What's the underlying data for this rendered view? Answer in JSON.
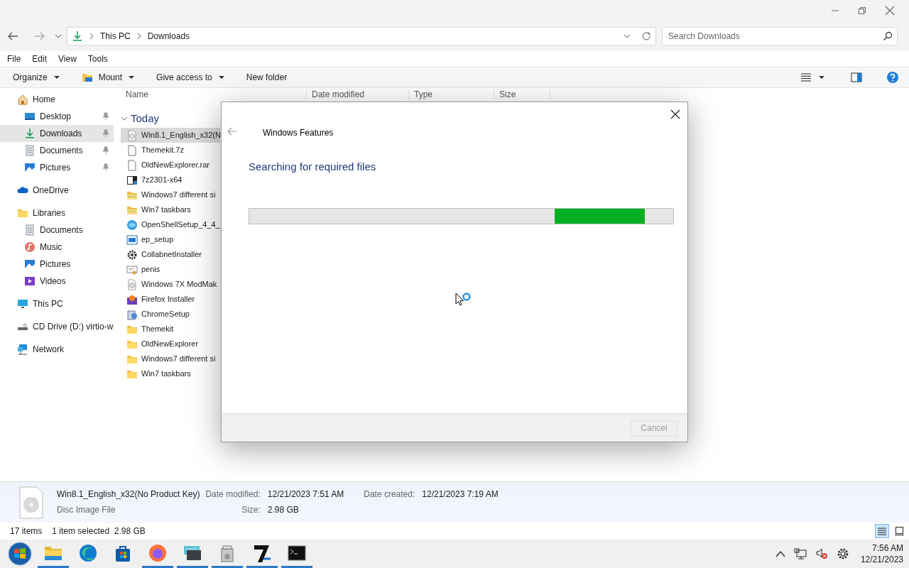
{
  "address_bar": {
    "path": [
      "This PC",
      "Downloads"
    ]
  },
  "search": {
    "placeholder": "Search Downloads"
  },
  "menu_bar": [
    "File",
    "Edit",
    "View",
    "Tools"
  ],
  "toolbar": [
    {
      "label": "Organize",
      "kind": "dropdown"
    },
    {
      "label": "Mount",
      "kind": "icon-dropdown"
    },
    {
      "label": "Give access to",
      "kind": "dropdown"
    },
    {
      "label": "New folder",
      "kind": "plain"
    }
  ],
  "navigation": [
    {
      "label": "Home",
      "kind": "home",
      "selected": false,
      "children": [
        {
          "label": "Desktop",
          "kind": "desktop",
          "pinned": true,
          "selected": false
        },
        {
          "label": "Downloads",
          "kind": "downloads",
          "pinned": true,
          "selected": true
        },
        {
          "label": "Documents",
          "kind": "documents",
          "pinned": true,
          "selected": false
        },
        {
          "label": "Pictures",
          "kind": "pictures",
          "pinned": true,
          "selected": false
        }
      ]
    },
    {
      "label": "OneDrive",
      "kind": "cloud",
      "selected": false
    },
    {
      "label": "Libraries",
      "kind": "folder",
      "selected": false,
      "children": [
        {
          "label": "Documents",
          "kind": "documents",
          "selected": false
        },
        {
          "label": "Music",
          "kind": "music",
          "selected": false
        },
        {
          "label": "Pictures",
          "kind": "pictures",
          "selected": false
        },
        {
          "label": "Videos",
          "kind": "videos",
          "selected": false
        }
      ]
    },
    {
      "label": "This PC",
      "kind": "pc",
      "selected": false
    },
    {
      "label": "CD Drive (D:) virtio-w",
      "kind": "drive",
      "selected": false
    },
    {
      "label": "Network",
      "kind": "network",
      "selected": false
    }
  ],
  "file_list": {
    "columns": [
      "Name",
      "Date modified",
      "Type",
      "Size"
    ],
    "group": {
      "label": "Today",
      "expanded": true
    },
    "rows": [
      {
        "name": "Win8.1_English_x32(N",
        "kind": "disc",
        "selected": true
      },
      {
        "name": "Themekit.7z",
        "kind": "file",
        "selected": false
      },
      {
        "name": "OldNewExplorer.rar",
        "kind": "file",
        "selected": false
      },
      {
        "name": "7z2301-x64",
        "kind": "sevenzip",
        "selected": false
      },
      {
        "name": "Windows7 different si",
        "kind": "zipfolder",
        "selected": false
      },
      {
        "name": "Win7 taskbars",
        "kind": "zipfolder",
        "selected": false
      },
      {
        "name": "OpenShellSetup_4_4_",
        "kind": "shell",
        "selected": false
      },
      {
        "name": "ep_setup",
        "kind": "app",
        "selected": false
      },
      {
        "name": "CollabnetInstaller",
        "kind": "gear",
        "selected": false
      },
      {
        "name": "penis",
        "kind": "cert",
        "selected": false
      },
      {
        "name": "Windows 7X ModMak",
        "kind": "disc",
        "selected": false
      },
      {
        "name": "Firefox Installer",
        "kind": "installer",
        "selected": false
      },
      {
        "name": "ChromeSetup",
        "kind": "setup",
        "selected": false
      },
      {
        "name": "Themekit",
        "kind": "folder",
        "selected": false
      },
      {
        "name": "OldNewExplorer",
        "kind": "folder",
        "selected": false
      },
      {
        "name": "Windows7 different si",
        "kind": "folder",
        "selected": false
      },
      {
        "name": "Win7 taskbars",
        "kind": "folder",
        "selected": false
      }
    ]
  },
  "dialog": {
    "title": "Windows Features",
    "heading": "Searching for required files",
    "progress": {
      "kind": "indeterminate"
    },
    "cancel": {
      "label": "Cancel",
      "disabled": true
    }
  },
  "details_pane": {
    "name": "Win8.1_English_x32(No Product Key)",
    "type": "Disc Image File",
    "fields": [
      {
        "label": "Date modified:",
        "value": "12/21/2023 7:51 AM"
      },
      {
        "label": "Date created:",
        "value": "12/21/2023 7:19 AM"
      },
      {
        "label": "Size:",
        "value": "2.98 GB"
      }
    ]
  },
  "status_bar": {
    "items": "17 items",
    "selection": "1 item selected  2.98 GB",
    "views": [
      {
        "kind": "details",
        "selected": true
      },
      {
        "kind": "tiles",
        "selected": false
      }
    ]
  },
  "taskbar": {
    "apps": [
      {
        "kind": "explorer",
        "running": true
      },
      {
        "kind": "edge",
        "running": false
      },
      {
        "kind": "store",
        "running": false
      },
      {
        "kind": "firefox",
        "running": true
      },
      {
        "kind": "keyboard",
        "running": true
      },
      {
        "kind": "package",
        "running": true
      },
      {
        "kind": "seven",
        "running": true
      },
      {
        "kind": "terminal",
        "running": true
      }
    ],
    "time": "7:56 AM",
    "date": "12/21/2023"
  }
}
